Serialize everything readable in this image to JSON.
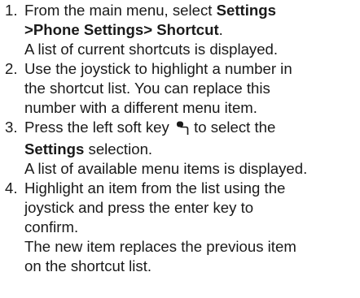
{
  "steps": [
    {
      "number": "1.",
      "l1_pre": "From the main menu, select ",
      "l1_bold": "Settings",
      "l2_bold": ">Phone Settings> Shortcut",
      "l2_post": ".",
      "l3": "A list of current shortcuts is displayed."
    },
    {
      "number": "2.",
      "l1": "Use the joystick to highlight a number in",
      "l2": "the shortcut list. You can replace this",
      "l3": "number with a different menu item."
    },
    {
      "number": "3.",
      "l1_pre": "Press the left soft key ",
      "l1_post": " to select  the",
      "l2_bold": "Settings",
      "l2_post": " selection.",
      "l3": "A list of available menu items is displayed.",
      "icon": "left-soft-key-icon"
    },
    {
      "number": "4.",
      "l1": "Highlight an item from the list using the",
      "l2": "joystick and press the enter key to",
      "l3": "confirm.",
      "l4": "The new item replaces the previous item",
      "l5": "on the shortcut list."
    }
  ]
}
